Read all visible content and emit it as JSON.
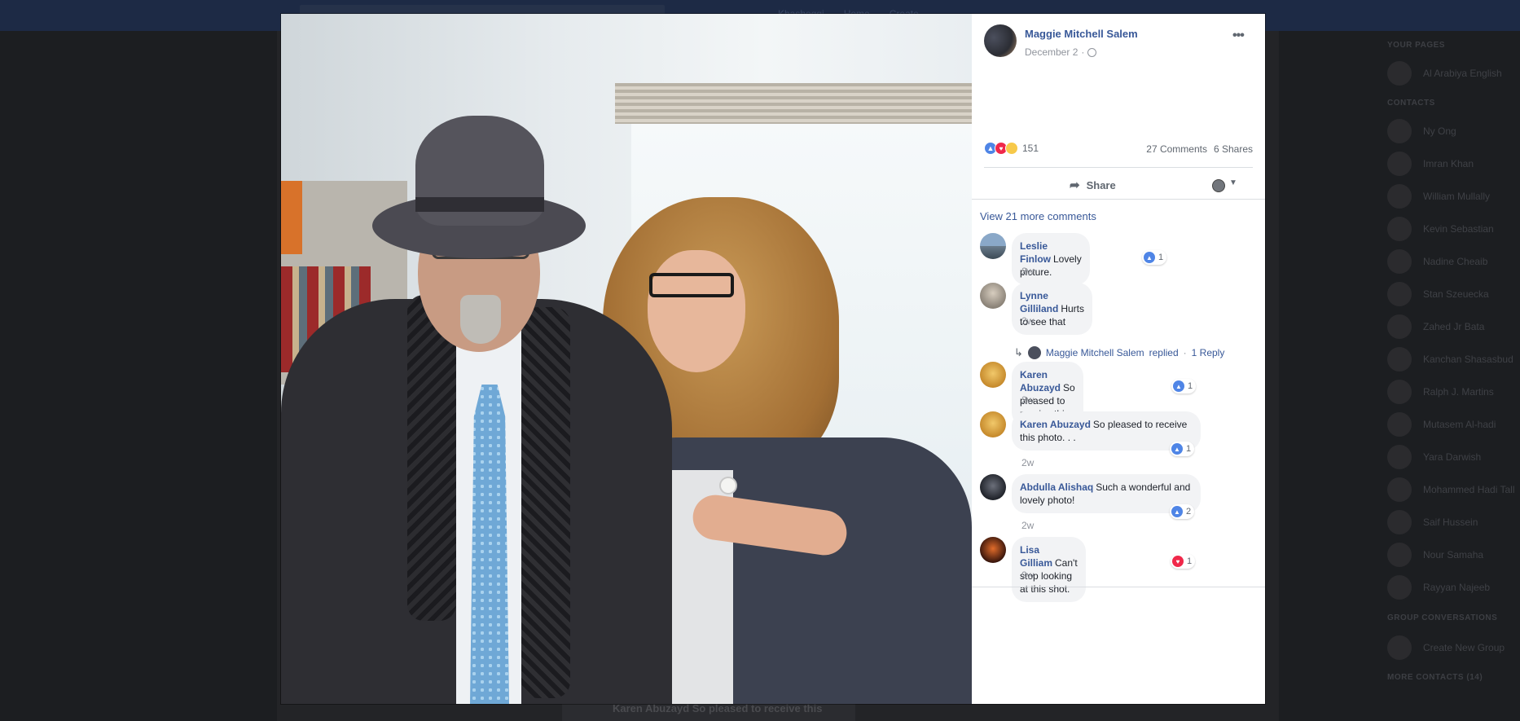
{
  "background": {
    "nav_items": [
      "Khashoggi",
      "Home",
      "Create"
    ],
    "feed_preview": "Karen Abuzayd So pleased to receive this",
    "rail_headings": {
      "pages": "YOUR PAGES",
      "contacts": "CONTACTS",
      "groups": "GROUP CONVERSATIONS",
      "more_contacts": "MORE CONTACTS (14)"
    },
    "pages": [
      "Al Arabiya English"
    ],
    "contacts": [
      "Ny Ong",
      "Imran Khan",
      "William Mullally",
      "Kevin Sebastian",
      "Nadine Cheaib",
      "Stan Szeuecka",
      "Zahed Jr Bata",
      "Kanchan Shasasbud",
      "Ralph J. Martins",
      "Mutasem Al-hadi",
      "Yara Darwish",
      "Mohammed Hadi Tall",
      "Saif Hussein",
      "Nour Samaha",
      "Rayyan Najeeb"
    ],
    "create_group": "Create New Group"
  },
  "post": {
    "author": "Maggie Mitchell Salem",
    "date": "December 2",
    "reaction_count": "151",
    "comments_count": "27 Comments",
    "shares_count": "6 Shares",
    "share_label": "Share",
    "view_more_comments": "View 21 more comments"
  },
  "comments": [
    {
      "author": "Leslie Finlow",
      "text": "Lovely picture.",
      "time": "2w",
      "reaction_count": "1",
      "reaction": "like"
    },
    {
      "author": "Lynne Gilliland",
      "text": "Hurts to see that",
      "time": "2w",
      "reaction_count": "",
      "reaction": ""
    },
    {
      "author": "Karen Abuzayd",
      "text": "So pleased to receive this.",
      "time": "2w",
      "reaction_count": "1",
      "reaction": "like"
    },
    {
      "author": "Karen Abuzayd",
      "text": "So pleased to receive this photo. . .",
      "time": "2w",
      "reaction_count": "1",
      "reaction": "like"
    },
    {
      "author": "Abdulla Alishaq",
      "text": "Such a wonderful and lovely photo!",
      "time": "2w",
      "reaction_count": "2",
      "reaction": "like"
    },
    {
      "author": "Lisa Gilliam",
      "text": "Can't stop looking at this shot.",
      "time": "2w",
      "reaction_count": "1",
      "reaction": "love"
    }
  ],
  "reply": {
    "author": "Maggie Mitchell Salem",
    "verb": "replied",
    "count": "1 Reply"
  },
  "colors": {
    "link": "#385898",
    "like": "#4f85e6",
    "love": "#f0284a",
    "overlay": "#1c1e21"
  }
}
